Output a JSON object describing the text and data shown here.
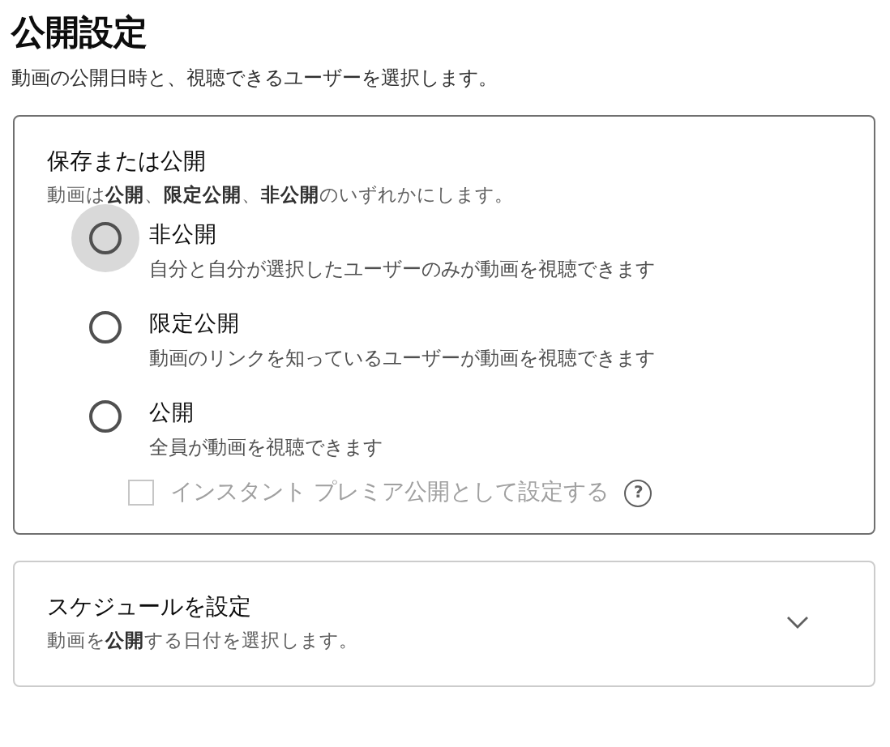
{
  "title": "公開設定",
  "subtitle": "動画の公開日時と、視聴できるユーザーを選択します。",
  "visibility": {
    "heading": "保存または公開",
    "description": "動画は**公開**、**限定公開**、**非公開**のいずれかにします。",
    "options": [
      {
        "label": "非公開",
        "description": "自分と自分が選択したユーザーのみが動画を視聴できます",
        "selected": false,
        "focused": true
      },
      {
        "label": "限定公開",
        "description": "動画のリンクを知っているユーザーが動画を視聴できます",
        "selected": false,
        "focused": false
      },
      {
        "label": "公開",
        "description": "全員が動画を視聴できます",
        "selected": false,
        "focused": false
      }
    ],
    "premiere": {
      "label": "インスタント プレミア公開として設定する",
      "checked": false,
      "disabled": true,
      "help": "?"
    }
  },
  "schedule": {
    "heading": "スケジュールを設定",
    "description": "動画を**公開**する日付を選択します。",
    "expanded": false
  }
}
